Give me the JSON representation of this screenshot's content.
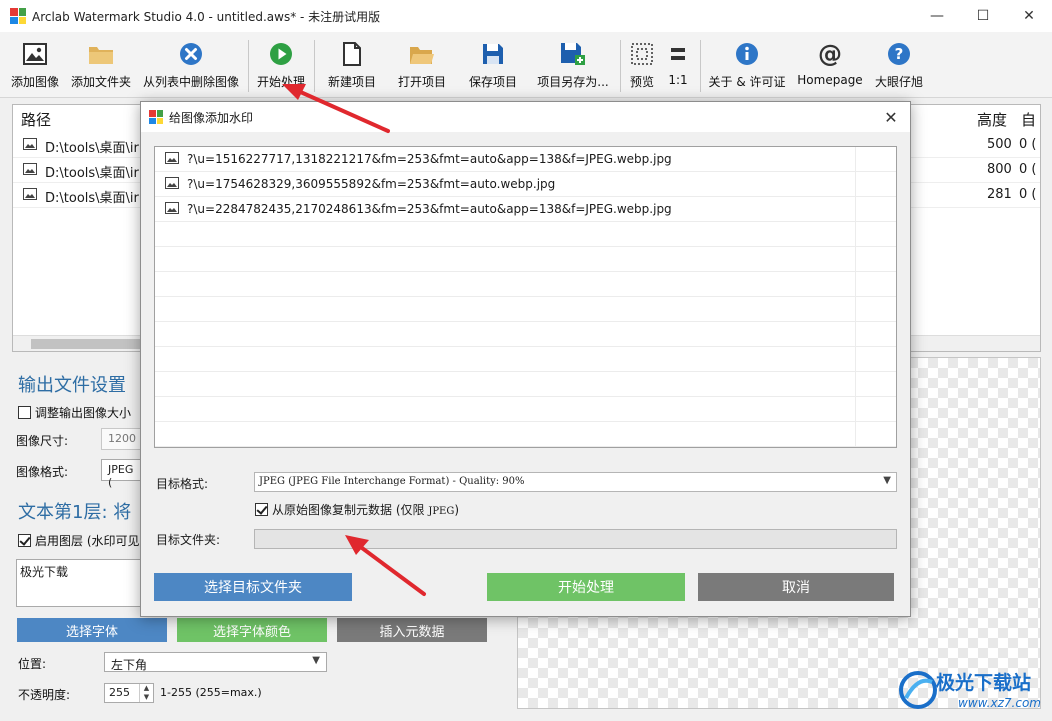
{
  "window": {
    "title": "Arclab Watermark Studio 4.0 - untitled.aws* - 未注册试用版",
    "minimize": "—",
    "maximize": "☐",
    "close": "✕"
  },
  "toolbar": {
    "add_image": "添加图像",
    "add_folder": "添加文件夹",
    "remove_from_list": "从列表中删除图像",
    "start_processing": "开始处理",
    "new_project": "新建项目",
    "open_project": "打开项目",
    "save_project": "保存项目",
    "save_project_as": "项目另存为...",
    "preview": "预览",
    "one_to_one": "1:1",
    "about_license": "关于 & 许可证",
    "homepage": "Homepage",
    "dayanzaitui": "大眼仔旭"
  },
  "main_table": {
    "col_path": "路径",
    "col_height": "高度",
    "col_auto": "自",
    "rows": [
      {
        "path": "D:\\tools\\桌面\\ir",
        "height": "500",
        "extra": "0 ("
      },
      {
        "path": "D:\\tools\\桌面\\ir",
        "height": "800",
        "extra": "0 ("
      },
      {
        "path": "D:\\tools\\桌面\\ir",
        "height": "281",
        "extra": "0 ("
      }
    ]
  },
  "left_panel": {
    "output_settings": "输出文件设置",
    "resize_output": "调整输出图像大小",
    "image_size_label": "图像尺寸:",
    "image_size_value": "1200",
    "image_format_label": "图像格式:",
    "image_format_value": "JPEG (",
    "text_layer_heading": "文本第1层: 将",
    "enable_layer": "启用图层 (水印可见",
    "watermark_text": "极光下载",
    "select_font": "选择字体",
    "select_font_color": "选择字体颜色",
    "insert_metadata": "插入元数据",
    "position_label": "位置:",
    "position_value": "左下角",
    "opacity_label": "不透明度:",
    "opacity_value": "255",
    "opacity_range": "1-255 (255=max.)"
  },
  "dialog": {
    "title": "给图像添加水印",
    "close": "✕",
    "files": [
      "?\\u=1516227717,1318221217&fm=253&fmt=auto&app=138&f=JPEG.webp.jpg",
      "?\\u=1754628329,3609555892&fm=253&fmt=auto.webp.jpg",
      "?\\u=2284782435,2170248613&fm=253&fmt=auto&app=138&f=JPEG.webp.jpg"
    ],
    "target_format_label": "目标格式:",
    "target_format_value": "JPEG (JPEG File Interchange Format) - Quality: 90%",
    "copy_metadata_label": "从原始图像复制元数据 (仅限 ",
    "copy_metadata_jpeg": "JPEG",
    "copy_metadata_end": ")",
    "target_folder_label": "目标文件夹:",
    "target_folder_value": "",
    "select_folder_button": "选择目标文件夹",
    "start_button": "开始处理",
    "cancel_button": "取消"
  },
  "watermark": {
    "brand": "极光下载站",
    "url": "www.xz7.com"
  },
  "colors": {
    "blue_button": "#4d87c4",
    "green_button": "#6fc366",
    "gray_button": "#7a7a7a",
    "accent_heading": "#2e6da4",
    "arrow_red": "#e0282e"
  }
}
